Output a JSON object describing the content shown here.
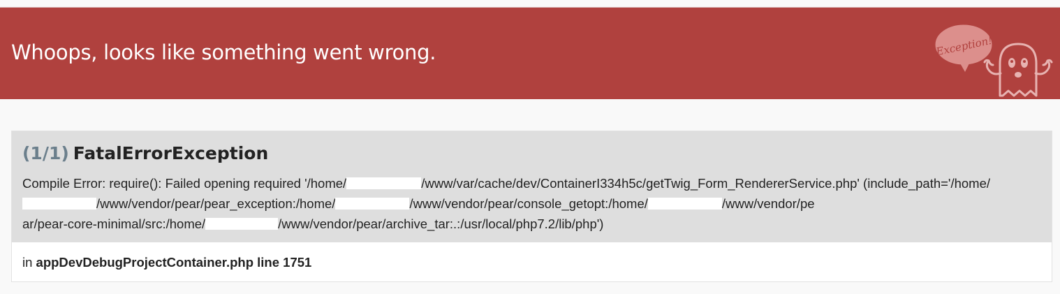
{
  "header": {
    "title": "Whoops, looks like something went wrong.",
    "logo_icon": "exception-ghost-icon",
    "logo_text": "Exception!",
    "background_color": "#b0413e"
  },
  "exception": {
    "counter": "(1/1)",
    "class_name": "FatalErrorException",
    "message_parts": [
      "Compile Error: require(): Failed opening required '/home/",
      "/www/var/cache/dev/ContainerI334h5c/getTwig_Form_RendererService.php' (include_path='/home/",
      "/www/vendor/pear/pear_exception:/home/",
      "/www/vendor/pear/console_getopt:/home/",
      "/www/vendor/pe",
      "ar/pear-core-minimal/src:/home/",
      "/www/vendor/pear/archive_tar:.:/usr/local/php7.2/lib/php')"
    ],
    "location_prefix": "in",
    "location_file": "appDevDebugProjectContainer.php line 1751"
  }
}
